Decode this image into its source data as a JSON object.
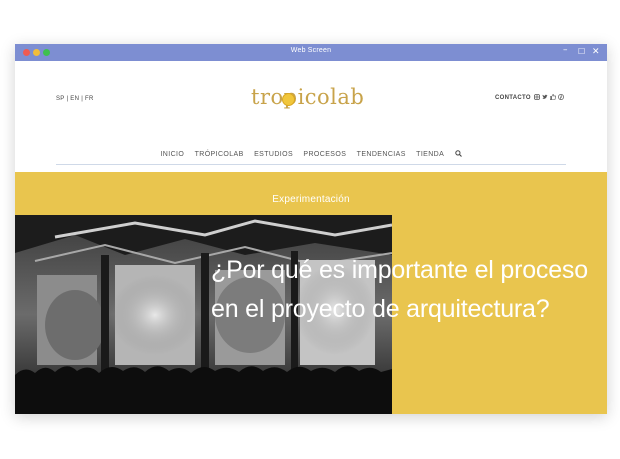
{
  "window": {
    "title": "Web Screen"
  },
  "header": {
    "languages": "SP | EN | FR",
    "logo_text": "tropicolab",
    "contact_label": "CONTACTO",
    "social_icons": [
      "instagram-icon",
      "twitter-icon",
      "thumbs-up-icon",
      "pinterest-icon"
    ]
  },
  "nav": {
    "items": [
      "INICIO",
      "TRÓPICOLAB",
      "ESTUDIOS",
      "PROCESOS",
      "TENDENCIAS",
      "TIENDA"
    ]
  },
  "hero": {
    "category": "Experimentación",
    "headline": "¿Por qué es importante el proceso en el proyecto de arquitectura?"
  },
  "colors": {
    "titlebar": "#7d8ed2",
    "accent_yellow": "#e9c54e",
    "logo_gold": "#c8a34a"
  }
}
